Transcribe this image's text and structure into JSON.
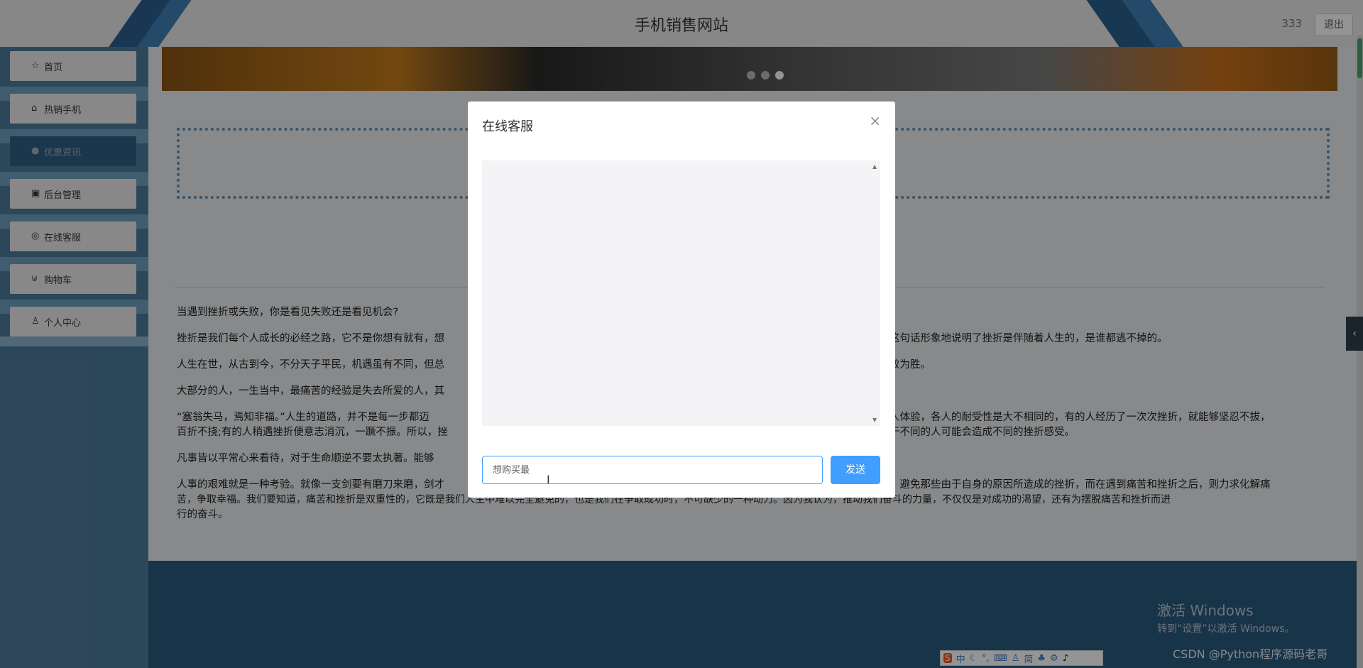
{
  "header": {
    "title": "手机销售网站",
    "username": "333",
    "logout_label": "退出"
  },
  "sidebar": {
    "items": [
      {
        "label": "首页",
        "icon": "☆"
      },
      {
        "label": "热销手机",
        "icon": "⌂"
      },
      {
        "label": "优惠资讯",
        "icon": "●"
      },
      {
        "label": "后台管理",
        "icon": "▣"
      },
      {
        "label": "在线客服",
        "icon": "◎"
      },
      {
        "label": "购物车",
        "icon": "⊍"
      },
      {
        "label": "个人中心",
        "icon": "♙"
      }
    ],
    "active_index": 2
  },
  "banner": {
    "slides": 3,
    "active_slide": 3
  },
  "article": {
    "paragraphs": [
      "当遇到挫折或失败，你是看见失败还是看见机会?",
      "挫折是我们每个人成长的必经之路，它不是你想有就有，想",
      "这句话形象地说明了挫折是伴随着人生的，是谁都逃不掉的。",
      "人生在世，从古到今，不分天子平民，机遇虽有不同，但总",
      "败为胜。",
      "大部分的人，一生当中，最痛苦的经验是失去所爱的人，其",
      "“塞翁失马，焉知非福。”人生的道路，并不是每一步都迈",
      "人体验，各人的耐受性是大不相同的，有的人经历了一次次挫折，就能够坚忍不拔，",
      "百折不挠;有的人稍遇挫折便意志消沉，一蹶不振。所以，挫",
      "于不同的人可能会造成不同的挫折感受。",
      "凡事皆以平常心来看待，对于生命顺逆不要太执著。能够",
      "人事的艰难就是一种考验。就像一支剑要有磨刀来磨，剑才",
      "、避免那些由于自身的原因所造成的挫折，而在遇到痛苦和挫折之后，则力求化解痛",
      "苦，争取幸福。我们要知道，痛苦和挫折是双重性的，它既是我们人生中难以完全避免的，也是我们在争取成功时，不可缺少的一种动力。因为我认为，推动我们奋斗的力量，不仅仅是对成功的渴望，还有为摆脱痛苦和挫折而进",
      "行的奋斗。"
    ]
  },
  "dialog": {
    "title": "在线客服",
    "close_icon": "×",
    "input_value": "想购买最",
    "send_label": "发送"
  },
  "watermark": {
    "line1": "激活 Windows",
    "line2": "转到“设置”以激活 Windows。"
  },
  "credit": "CSDN @Python程序源码老哥",
  "ime": {
    "chars": [
      "中",
      "简"
    ]
  },
  "colors": {
    "primary": "#409eff",
    "sidebar": "#4f7b9c",
    "footer": "#2a5a7f"
  }
}
